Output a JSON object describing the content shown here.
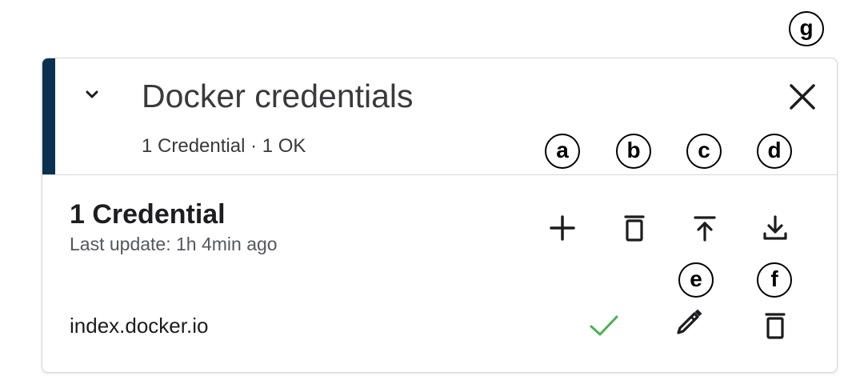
{
  "panel": {
    "title": "Docker credentials",
    "subtitle": "1 Credential · 1 OK",
    "accent_color": "#0b3150",
    "collapse_icon": "chevron-down-icon",
    "close_icon": "close-icon"
  },
  "section": {
    "title": "1 Credential",
    "last_update": "Last update: 1h 4min ago",
    "actions": [
      {
        "name": "add-credential-button",
        "icon": "plus-icon"
      },
      {
        "name": "delete-all-button",
        "icon": "trash-icon"
      },
      {
        "name": "upload-button",
        "icon": "upload-icon"
      },
      {
        "name": "download-button",
        "icon": "download-icon"
      }
    ]
  },
  "credentials": [
    {
      "host": "index.docker.io",
      "status_icon": "check-icon",
      "status_color": "#4caf50",
      "actions": [
        {
          "name": "edit-credential-button",
          "icon": "pencil-icon"
        },
        {
          "name": "delete-credential-button",
          "icon": "trash-icon"
        }
      ]
    }
  ],
  "callouts": [
    "a",
    "b",
    "c",
    "d",
    "e",
    "f",
    "g"
  ]
}
